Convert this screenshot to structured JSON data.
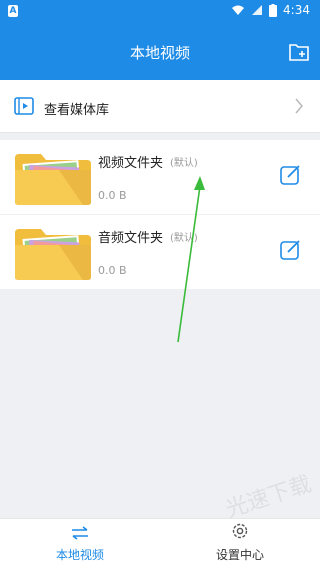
{
  "statusbar": {
    "time": "4:34",
    "badge": "A"
  },
  "header": {
    "title": "本地视频"
  },
  "media": {
    "label": "查看媒体库"
  },
  "folders": [
    {
      "name": "视频文件夹",
      "tag": "(默认)",
      "size": "0.0 B"
    },
    {
      "name": "音频文件夹",
      "tag": "(默认)",
      "size": "0.0 B"
    }
  ],
  "nav": [
    {
      "label": "本地视频"
    },
    {
      "label": "设置中心"
    }
  ],
  "watermark": "光速下载",
  "colors": {
    "primary": "#1e8be6",
    "folder": "#f5c74b"
  }
}
